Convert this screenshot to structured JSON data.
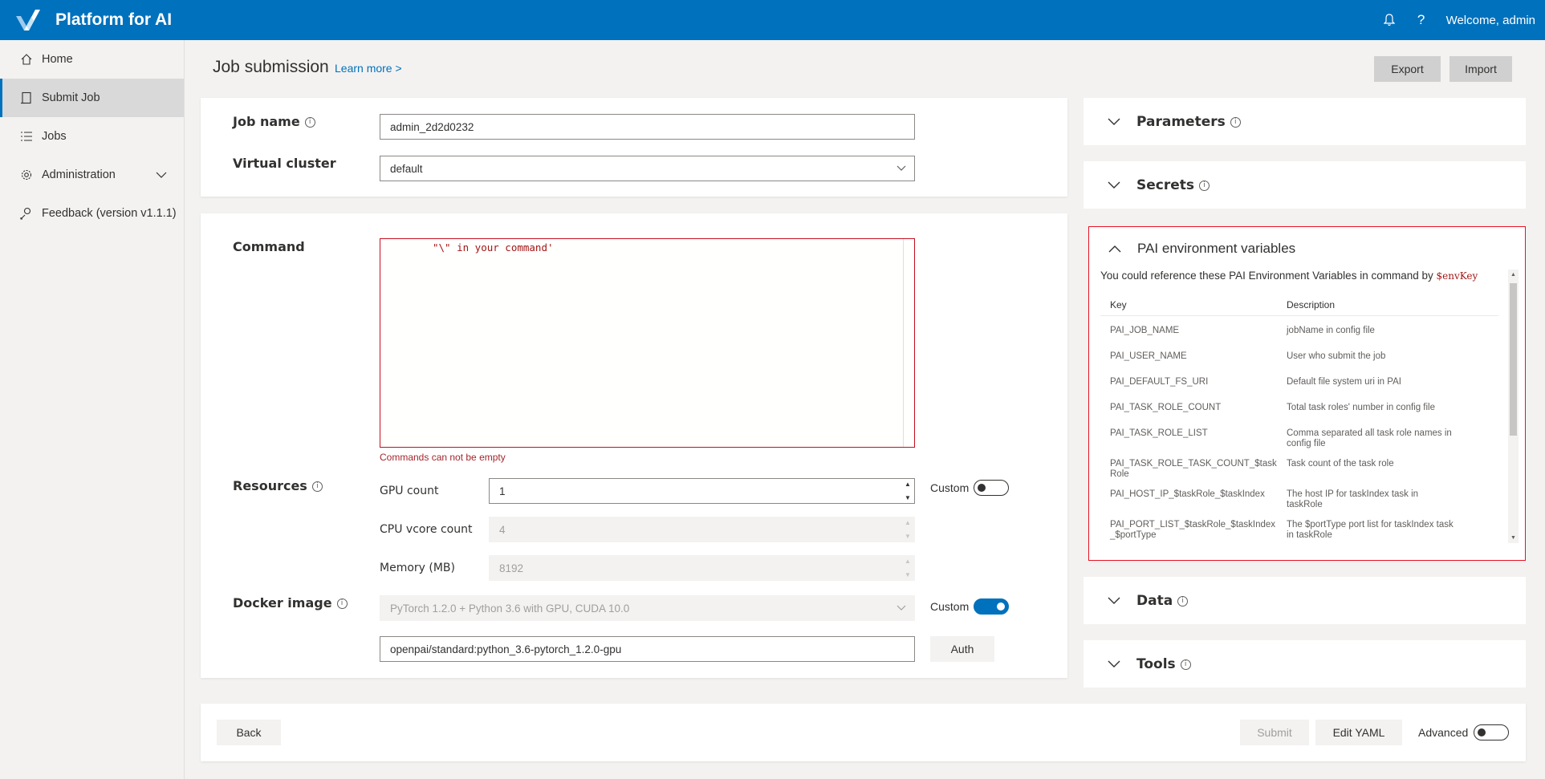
{
  "app": {
    "title": "Platform for AI",
    "welcome": "Welcome, admin",
    "brand_color": "#0071bc"
  },
  "sidebar": {
    "items": [
      {
        "label": "Home",
        "icon": "home-icon"
      },
      {
        "label": "Submit Job",
        "icon": "submit-job-icon",
        "active": true
      },
      {
        "label": "Jobs",
        "icon": "list-icon"
      },
      {
        "label": "Administration",
        "icon": "gear-icon"
      },
      {
        "label": "Feedback (version v1.1.1)",
        "icon": "feedback-icon"
      }
    ]
  },
  "header": {
    "title": "Job submission",
    "learn_more": "Learn more >",
    "export_label": "Export",
    "import_label": "Import"
  },
  "job": {
    "name_label": "Job name",
    "name_value": "admin_2d2d0232",
    "cluster_label": "Virtual cluster",
    "cluster_value": "default"
  },
  "command": {
    "label": "Command",
    "text": "\"\\\" in your command'",
    "error": "Commands can not be empty"
  },
  "resources": {
    "label": "Resources",
    "gpu_label": "GPU count",
    "gpu_value": "1",
    "cpu_label": "CPU vcore count",
    "cpu_value": "4",
    "mem_label": "Memory (MB)",
    "mem_value": "8192",
    "custom_label": "Custom",
    "custom_on": false
  },
  "docker": {
    "label": "Docker image",
    "selected": "PyTorch 1.2.0 + Python 3.6 with GPU, CUDA 10.0",
    "custom_label": "Custom",
    "custom_on": true,
    "image_value": "openpai/standard:python_3.6-pytorch_1.2.0-gpu",
    "auth_label": "Auth"
  },
  "footer": {
    "back_label": "Back",
    "submit_label": "Submit",
    "edit_yaml_label": "Edit YAML",
    "advanced_label": "Advanced",
    "advanced_on": false
  },
  "panels": {
    "parameters": "Parameters",
    "secrets": "Secrets",
    "env_title": "PAI environment variables",
    "data": "Data",
    "tools": "Tools"
  },
  "env": {
    "desc_prefix": "You could reference these PAI Environment Variables in command by ",
    "desc_code": "$envKey",
    "col_key": "Key",
    "col_desc": "Description",
    "rows": [
      {
        "key": "PAI_JOB_NAME",
        "desc": "jobName in config file"
      },
      {
        "key": "PAI_USER_NAME",
        "desc": "User who submit the job"
      },
      {
        "key": "PAI_DEFAULT_FS_URI",
        "desc": "Default file system uri in PAI"
      },
      {
        "key": "PAI_TASK_ROLE_COUNT",
        "desc": "Total task roles' number in config file"
      },
      {
        "key": "PAI_TASK_ROLE_LIST",
        "desc": "Comma separated all task role names in config file"
      },
      {
        "key": "PAI_TASK_ROLE_TASK_COUNT_$taskRole",
        "desc": "Task count of the task role"
      },
      {
        "key": "PAI_HOST_IP_$taskRole_$taskIndex",
        "desc": "The host IP for taskIndex task in taskRole"
      },
      {
        "key": "PAI_PORT_LIST_$taskRole_$taskIndex_$portType",
        "desc": "The $portType port list for taskIndex task in taskRole"
      }
    ]
  }
}
